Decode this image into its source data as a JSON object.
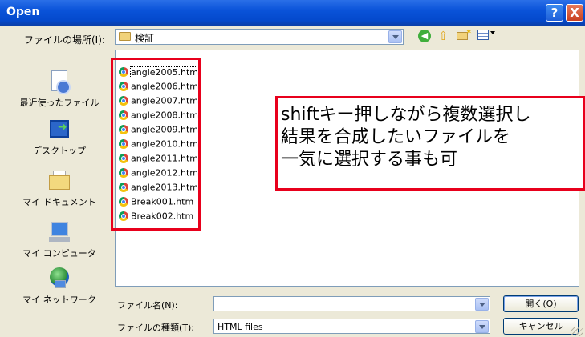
{
  "window": {
    "title": "Open",
    "help_label": "?",
    "close_label": "X"
  },
  "lookin": {
    "label": "ファイルの場所(I):",
    "value": "検証"
  },
  "places": [
    {
      "label": "最近使ったファイル",
      "icon": "recent-docs-icon"
    },
    {
      "label": "デスクトップ",
      "icon": "desktop-icon"
    },
    {
      "label": "マイ ドキュメント",
      "icon": "my-documents-icon"
    },
    {
      "label": "マイ コンピュータ",
      "icon": "my-computer-icon"
    },
    {
      "label": "マイ ネットワーク",
      "icon": "my-network-icon"
    }
  ],
  "files": [
    "angle2005.htm",
    "angle2006.htm",
    "angle2007.htm",
    "angle2008.htm",
    "angle2009.htm",
    "angle2010.htm",
    "angle2011.htm",
    "angle2012.htm",
    "angle2013.htm",
    "Break001.htm",
    "Break002.htm"
  ],
  "annotation": {
    "lines": [
      "shiftキー押しながら複数選択し",
      "結果を合成したいファイルを",
      "一気に選択する事も可"
    ],
    "border_color": "#e8001c"
  },
  "filename": {
    "label": "ファイル名(N):",
    "value": ""
  },
  "filetype": {
    "label": "ファイルの種類(T):",
    "value": "HTML files"
  },
  "buttons": {
    "open": "開く(O)",
    "cancel": "キャンセル"
  }
}
